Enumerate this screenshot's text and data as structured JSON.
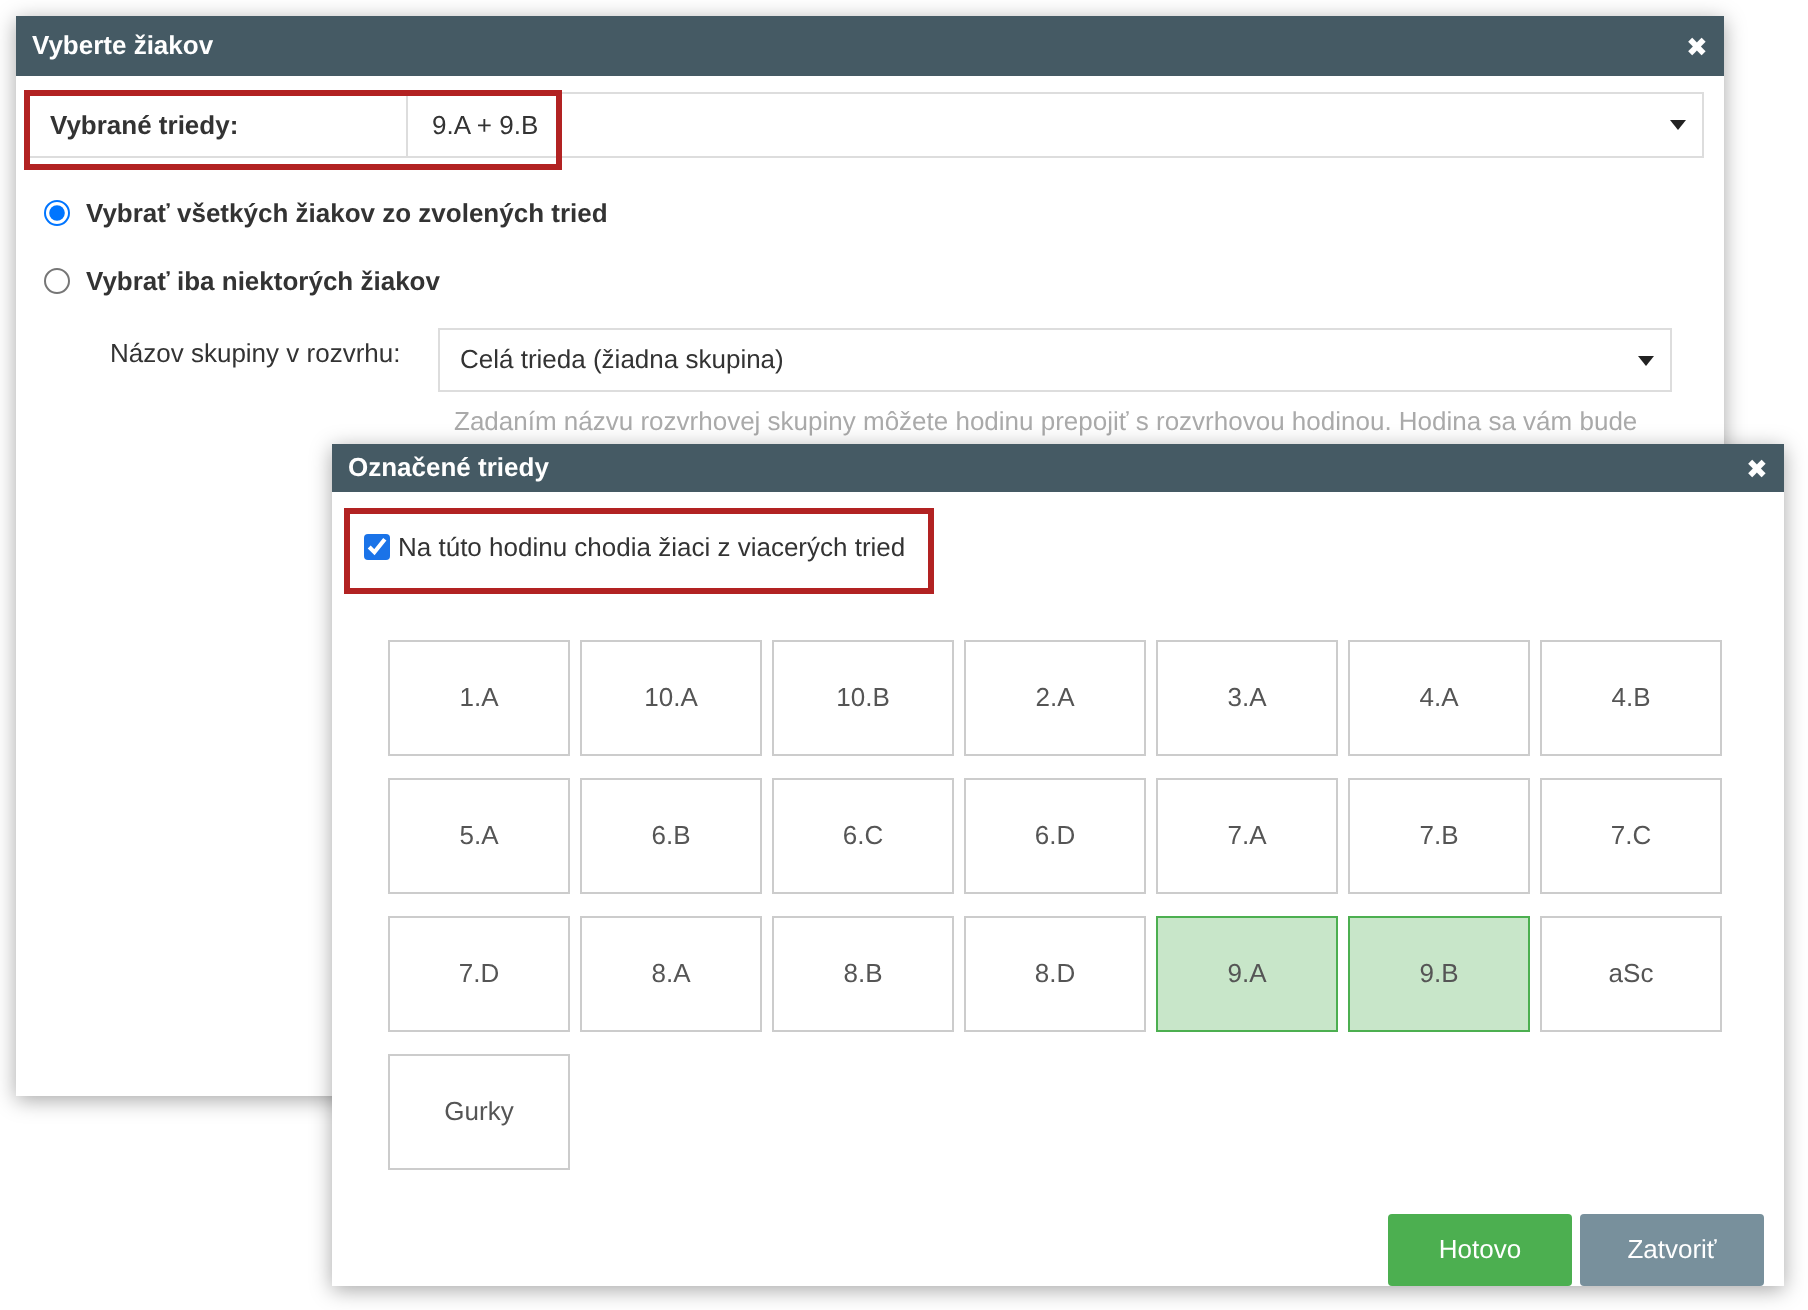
{
  "main_dialog": {
    "title": "Vyberte žiakov",
    "close": "✖",
    "class_select": {
      "label": "Vybrané triedy:",
      "value": "9.A + 9.B"
    },
    "options": [
      {
        "label": "Vybrať všetkých žiakov zo zvolených tried",
        "selected": true
      },
      {
        "label": "Vybrať iba niektorých žiakov",
        "selected": false
      }
    ],
    "group_field": {
      "label": "Názov skupiny v rozvrhu:",
      "value": "Celá trieda (žiadna skupina)"
    },
    "hint": "Zadaním názvu rozvrhovej skupiny môžete hodinu prepojiť s rozvrhovou hodinou. Hodina sa vám bude"
  },
  "classes_dialog": {
    "title": "Označené triedy",
    "close": "✖",
    "multi_class": {
      "label": "Na túto hodinu chodia žiaci z viacerých tried",
      "checked": true
    },
    "classes": [
      {
        "label": "1.A",
        "selected": false
      },
      {
        "label": "10.A",
        "selected": false
      },
      {
        "label": "10.B",
        "selected": false
      },
      {
        "label": "2.A",
        "selected": false
      },
      {
        "label": "3.A",
        "selected": false
      },
      {
        "label": "4.A",
        "selected": false
      },
      {
        "label": "4.B",
        "selected": false
      },
      {
        "label": "5.A",
        "selected": false
      },
      {
        "label": "6.B",
        "selected": false
      },
      {
        "label": "6.C",
        "selected": false
      },
      {
        "label": "6.D",
        "selected": false
      },
      {
        "label": "7.A",
        "selected": false
      },
      {
        "label": "7.B",
        "selected": false
      },
      {
        "label": "7.C",
        "selected": false
      },
      {
        "label": "7.D",
        "selected": false
      },
      {
        "label": "8.A",
        "selected": false
      },
      {
        "label": "8.B",
        "selected": false
      },
      {
        "label": "8.D",
        "selected": false
      },
      {
        "label": "9.A",
        "selected": true
      },
      {
        "label": "9.B",
        "selected": true
      },
      {
        "label": "aSc",
        "selected": false
      },
      {
        "label": "Gurky",
        "selected": false
      }
    ],
    "buttons": [
      {
        "label": "Hotovo",
        "kind": "primary"
      },
      {
        "label": "Zatvoriť",
        "kind": "secondary"
      }
    ]
  }
}
